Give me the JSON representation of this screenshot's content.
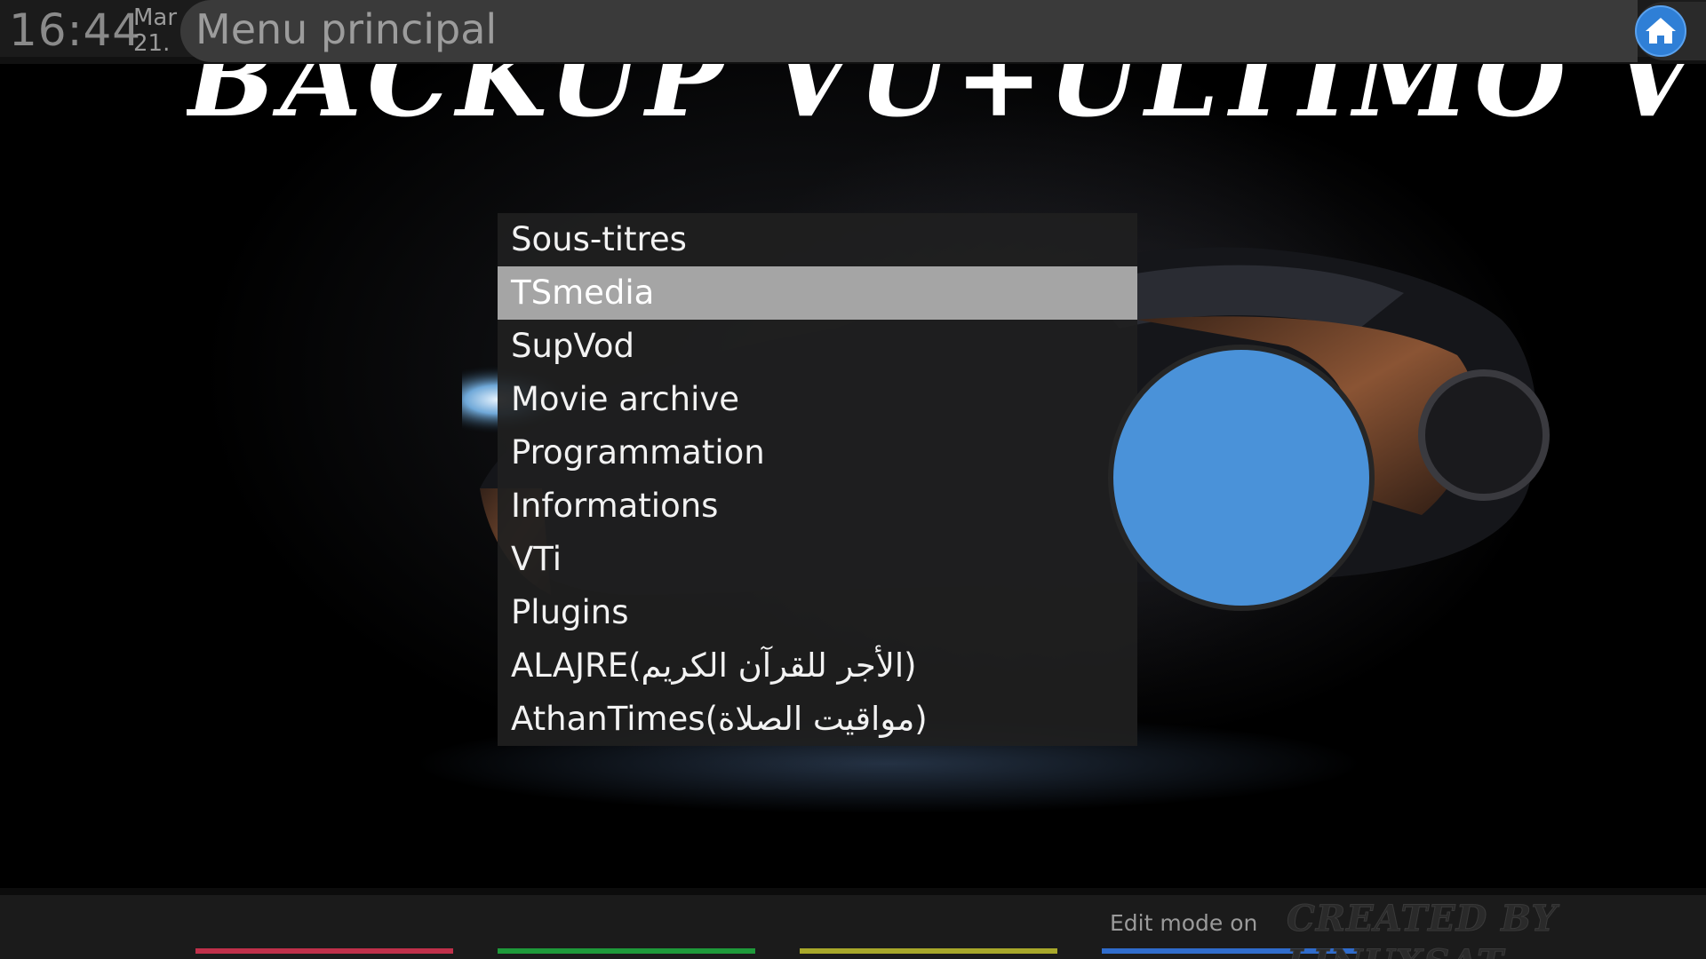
{
  "header": {
    "time": "16:44",
    "date_month": "Mar",
    "date_day": "21.",
    "title": "Menu principal",
    "home_icon": "home-icon",
    "home_color": "#2f7fd6"
  },
  "banner": {
    "text": "BACKUP VU+ULTIMO VTI"
  },
  "menu": {
    "selected_index": 1,
    "items": [
      {
        "label": "Sous-titres"
      },
      {
        "label": "TSmedia"
      },
      {
        "label": "SupVod"
      },
      {
        "label": "Movie archive"
      },
      {
        "label": "Programmation"
      },
      {
        "label": "Informations"
      },
      {
        "label": "VTi"
      },
      {
        "label": "Plugins"
      },
      {
        "label": "ALAJRE(الأجر للقرآن الكريم)"
      },
      {
        "label": "AthanTimes(مواقيت الصلاة)"
      }
    ]
  },
  "footer": {
    "color_keys": [
      {
        "name": "red",
        "color": "#c0304a"
      },
      {
        "name": "green",
        "color": "#1e9a3a"
      },
      {
        "name": "yellow",
        "color": "#a8a82a"
      },
      {
        "name": "blue",
        "color": "#2f6ccc"
      }
    ],
    "edit_mode_text": "Edit mode on",
    "credit_text": "CREATED BY LINUXSAT"
  }
}
